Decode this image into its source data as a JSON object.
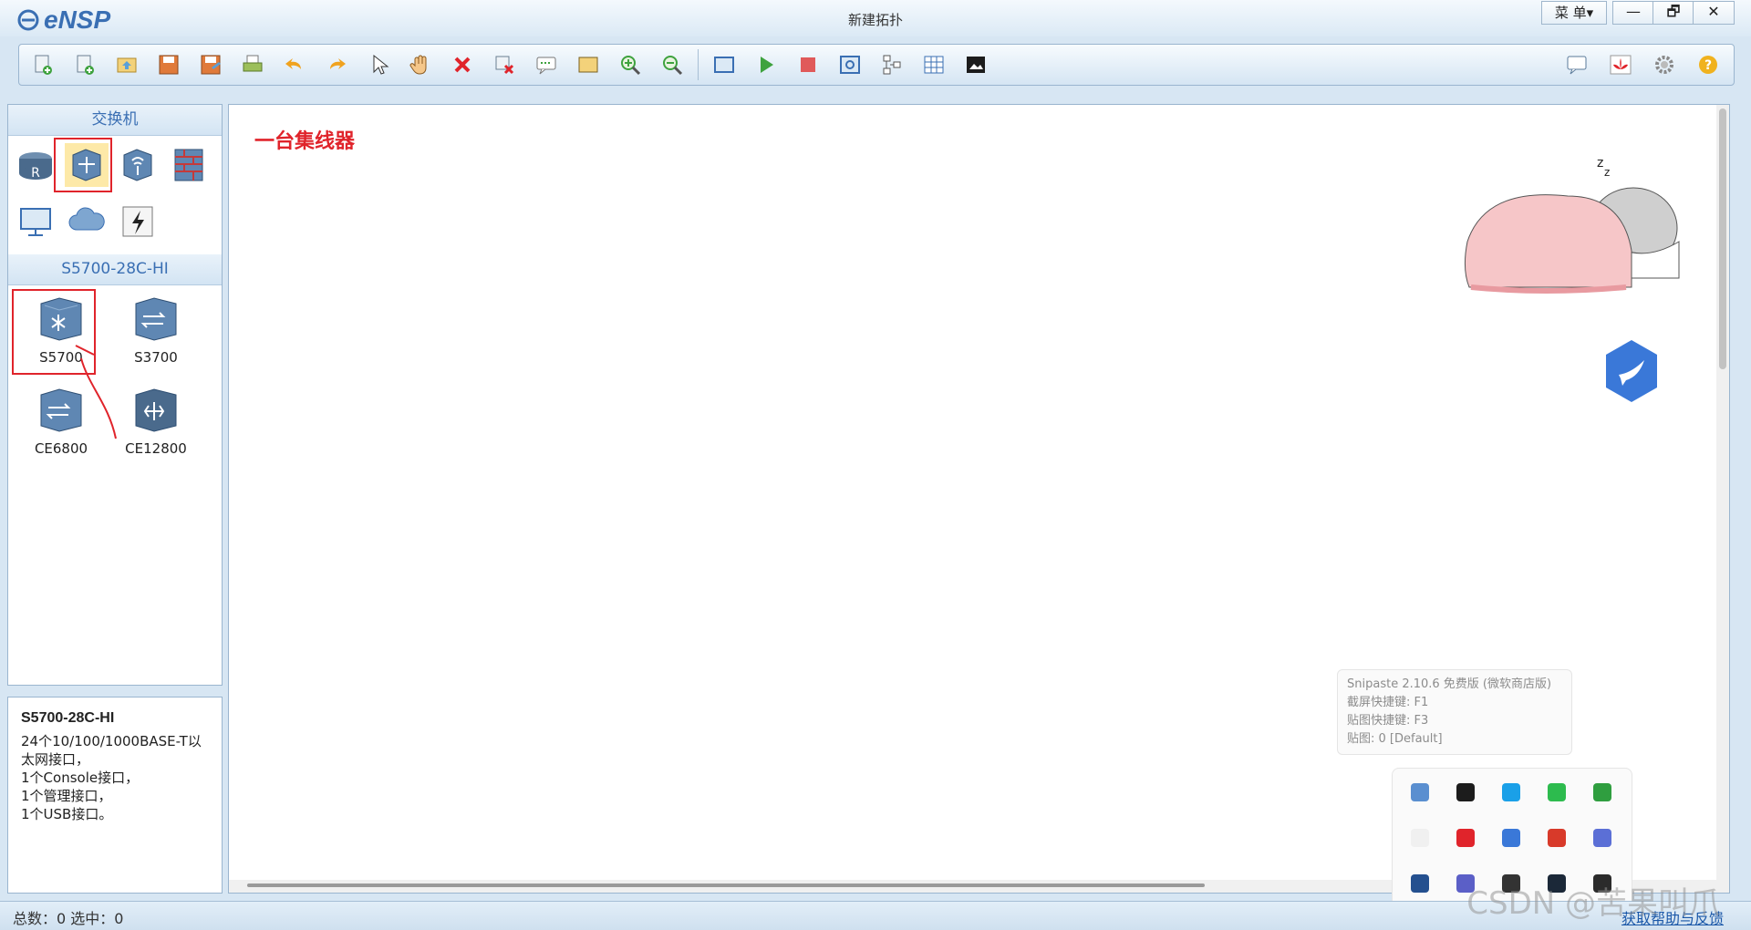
{
  "app": {
    "name": "eNSP",
    "window_title": "新建拓扑",
    "menu_label": "菜 单▾"
  },
  "window_controls": {
    "minimize": "—",
    "restore": "🗗",
    "close": "✕"
  },
  "toolbar": {
    "left_icons": [
      "new-topology-icon",
      "new-example-icon",
      "open-icon",
      "save-icon",
      "save-as-icon",
      "print-icon",
      "undo-icon",
      "redo-icon",
      "select-pointer-icon",
      "hand-pan-icon",
      "delete-icon",
      "delete-connection-icon",
      "text-note-icon",
      "color-block-icon",
      "zoom-in-icon",
      "zoom-out-icon",
      "fit-view-icon",
      "start-device-icon",
      "stop-device-icon",
      "capture-icon",
      "topology-icon",
      "grid-icon",
      "display-icon"
    ],
    "right_icons": [
      "chat-icon",
      "huawei-icon",
      "settings-icon",
      "help-icon"
    ]
  },
  "left_panel": {
    "category_header": "交换机",
    "categories": [
      "router-icon",
      "switch-icon",
      "wireless-icon",
      "firewall-icon",
      "pc-icon",
      "cloud-icon",
      "power-icon"
    ],
    "model_header": "S5700-28C-HI",
    "models": [
      {
        "label": "S5700"
      },
      {
        "label": "S3700"
      },
      {
        "label": "CE6800"
      },
      {
        "label": "CE12800"
      }
    ]
  },
  "info_panel": {
    "title": "S5700-28C-HI",
    "lines": [
      "24个10/100/1000BASE-T以",
      "太网接口，",
      "1个Console接口，",
      "1个管理接口，",
      "1个USB接口。"
    ]
  },
  "canvas": {
    "annotation": "一台集线器"
  },
  "snipaste": {
    "line1": "Snipaste 2.10.6 免费版 (微软商店版)",
    "line2": "截屏快捷键: F1",
    "line3": "贴图快捷键: F3",
    "line4": "贴图: 0 [Default]"
  },
  "tray_icons": [
    {
      "name": "tray-app-1-icon",
      "color": "#5a8fd0"
    },
    {
      "name": "tray-bookmark-icon",
      "color": "#1c1c1c"
    },
    {
      "name": "tray-app-3-icon",
      "color": "#1aa0e8"
    },
    {
      "name": "tray-wechat-icon",
      "color": "#2dbb4e"
    },
    {
      "name": "tray-xbox-icon",
      "color": "#2f9e3f"
    },
    {
      "name": "tray-empty-icon",
      "color": "#f0f0f0"
    },
    {
      "name": "tray-netease-icon",
      "color": "#e0242b"
    },
    {
      "name": "tray-feishu-icon",
      "color": "#3a78d8"
    },
    {
      "name": "tray-vmware-icon",
      "color": "#d83a2a"
    },
    {
      "name": "tray-app-10-icon",
      "color": "#5b6fd6"
    },
    {
      "name": "tray-hd-icon",
      "color": "#24508f"
    },
    {
      "name": "tray-teams-icon",
      "color": "#5b5fc7"
    },
    {
      "name": "tray-app-13-icon",
      "color": "#333333"
    },
    {
      "name": "tray-steam-icon",
      "color": "#1b2838"
    },
    {
      "name": "tray-nvidia-icon",
      "color": "#2b2b2b"
    }
  ],
  "statusbar": {
    "text": "总数：0  选中：0",
    "help_link": "获取帮助与反馈"
  },
  "watermark": "CSDN @苦果叫爪"
}
